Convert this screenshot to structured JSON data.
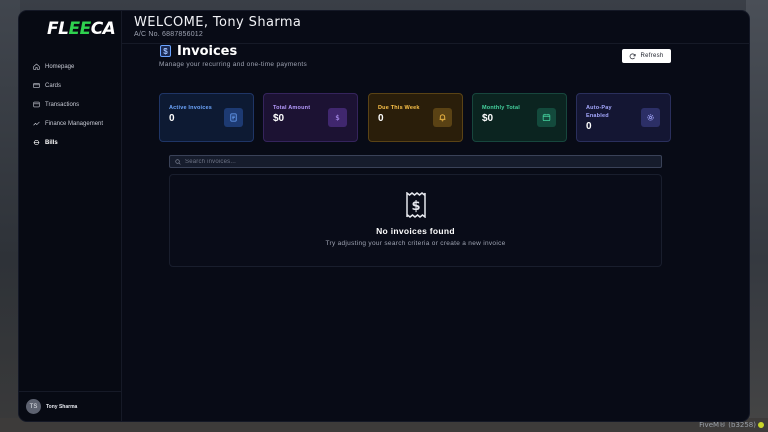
{
  "brand": {
    "logo_left": "FL",
    "logo_accent": "EE",
    "logo_right": "CA"
  },
  "header": {
    "welcome": "WELCOME, Tony Sharma",
    "account": "A/C No. 6887856012"
  },
  "sidebar": {
    "items": [
      {
        "label": "Homepage",
        "icon": "home-icon"
      },
      {
        "label": "Cards",
        "icon": "card-icon"
      },
      {
        "label": "Transactions",
        "icon": "transactions-icon"
      },
      {
        "label": "Finance Management",
        "icon": "trend-icon"
      },
      {
        "label": "Bills",
        "icon": "bills-icon",
        "active": true
      }
    ],
    "user": {
      "initials": "TS",
      "name": "Tony Sharma"
    }
  },
  "main": {
    "title": "Invoices",
    "subtitle": "Manage your recurring and one-time payments",
    "refresh_label": "Refresh",
    "stats": [
      {
        "label": "Active Invoices",
        "value": "0",
        "color": "#6ea7ff"
      },
      {
        "label": "Total Amount",
        "value": "$0",
        "color": "#b79cff"
      },
      {
        "label": "Due This Week",
        "value": "0",
        "color": "#ffc54a"
      },
      {
        "label": "Monthly Total",
        "value": "$0",
        "color": "#45d39f"
      },
      {
        "label": "Auto-Pay Enabled",
        "value": "0",
        "color": "#a6a9ff"
      }
    ],
    "search_placeholder": "Search invoices...",
    "empty_title": "No invoices found",
    "empty_subtitle": "Try adjusting your search criteria or create a new invoice"
  },
  "watermark": "FiveM® (b3258)"
}
